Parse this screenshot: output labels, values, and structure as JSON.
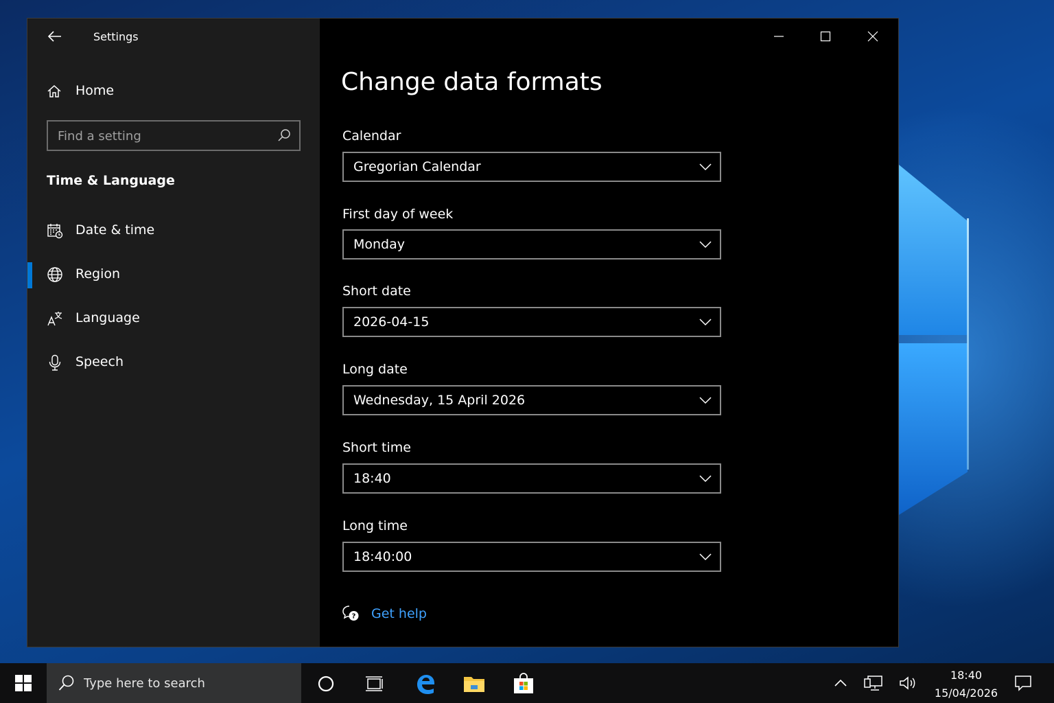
{
  "window": {
    "app_title": "Settings",
    "controls": {
      "minimize": "minimize",
      "maximize": "maximize",
      "close": "close"
    }
  },
  "sidebar": {
    "home_label": "Home",
    "search_placeholder": "Find a setting",
    "section_title": "Time & Language",
    "items": [
      {
        "label": "Date & time",
        "icon": "calendar-clock-icon",
        "selected": false
      },
      {
        "label": "Region",
        "icon": "globe-icon",
        "selected": true
      },
      {
        "label": "Language",
        "icon": "language-icon",
        "selected": false
      },
      {
        "label": "Speech",
        "icon": "microphone-icon",
        "selected": false
      }
    ]
  },
  "content": {
    "title": "Change data formats",
    "fields": [
      {
        "label": "Calendar",
        "value": "Gregorian Calendar"
      },
      {
        "label": "First day of week",
        "value": "Monday"
      },
      {
        "label": "Short date",
        "value": "2026-04-15"
      },
      {
        "label": "Long date",
        "value": "Wednesday, 15 April 2026"
      },
      {
        "label": "Short time",
        "value": "18:40"
      },
      {
        "label": "Long time",
        "value": "18:40:00"
      }
    ],
    "help_link": "Get help"
  },
  "taskbar": {
    "search_placeholder": "Type here to search",
    "time": "18:40",
    "date": "15/04/2026"
  },
  "colors": {
    "accent": "#0078d7",
    "link": "#3fa2ff",
    "sidebar_bg": "#1c1c1c",
    "content_bg": "#000000"
  }
}
